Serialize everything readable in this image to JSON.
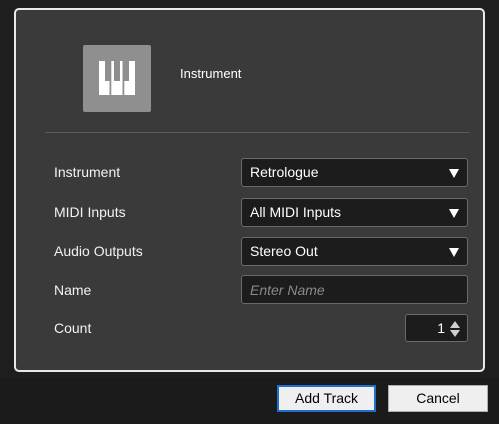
{
  "header": {
    "track_type": "Instrument",
    "icon": "piano-keys-icon"
  },
  "form": {
    "instrument": {
      "label": "Instrument",
      "value": "Retrologue"
    },
    "midi_inputs": {
      "label": "MIDI Inputs",
      "value": "All MIDI Inputs"
    },
    "audio_outputs": {
      "label": "Audio Outputs",
      "value": "Stereo Out"
    },
    "name": {
      "label": "Name",
      "value": "",
      "placeholder": "Enter Name"
    },
    "count": {
      "label": "Count",
      "value": "1"
    }
  },
  "buttons": {
    "add_track": "Add Track",
    "cancel": "Cancel"
  },
  "colors": {
    "panel_bg": "#3a3a3a",
    "panel_border": "#e9e9e9",
    "field_bg": "#1c1c1c",
    "icon_bg": "#8f8f8f",
    "primary_border": "#1f6fd0"
  }
}
